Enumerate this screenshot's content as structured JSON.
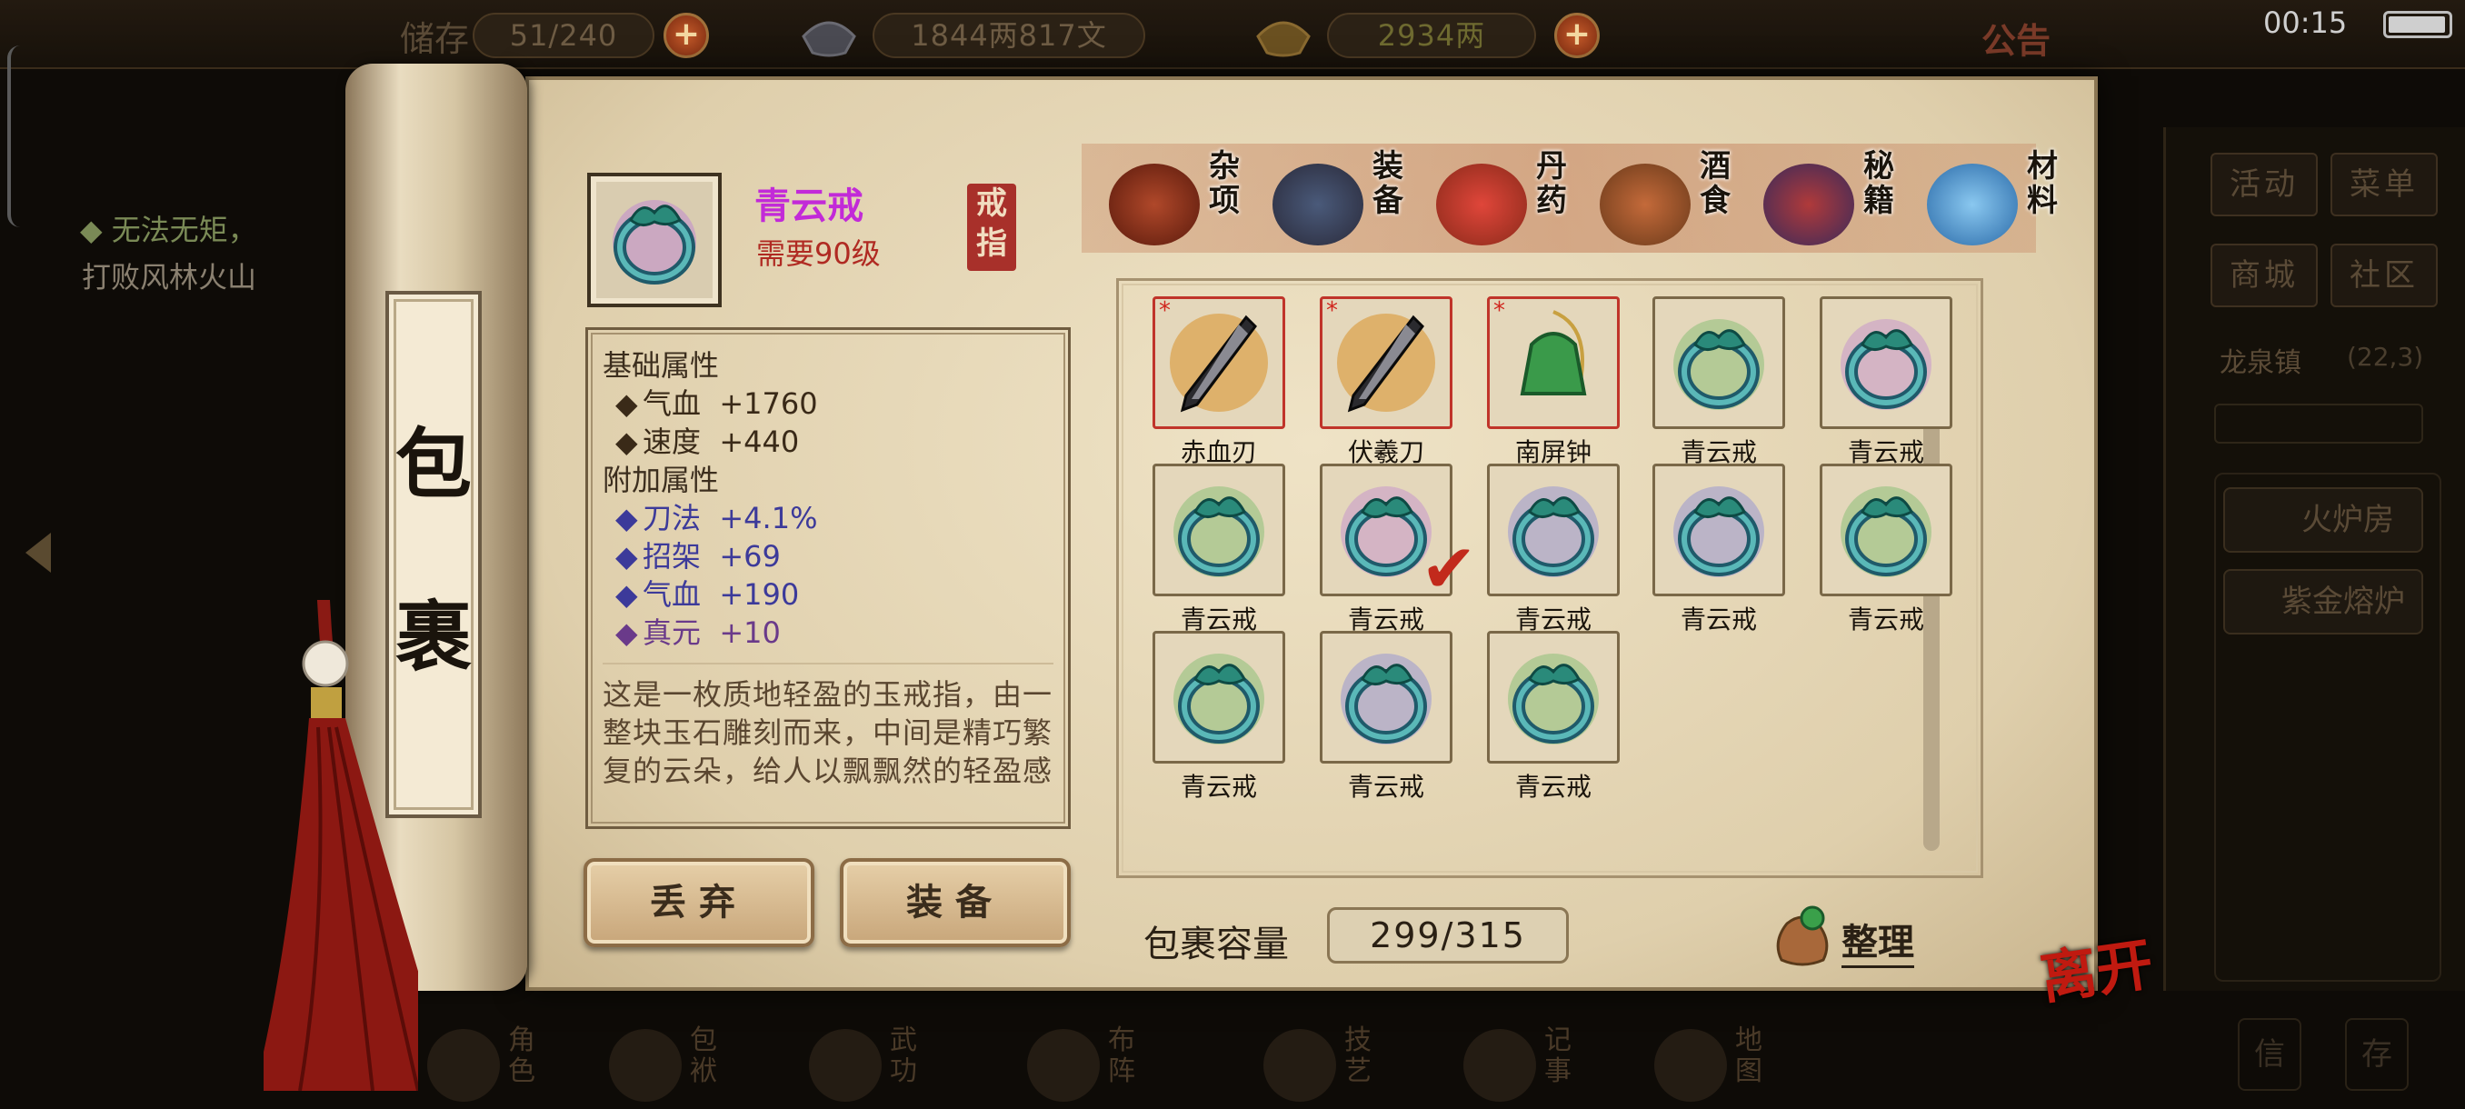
{
  "topbar": {
    "storage": "51/240",
    "storage_prefix": "储存",
    "currency_silver": "1844两817文",
    "currency_gold": "2934两",
    "notice": "公告",
    "time": "00:15"
  },
  "quest": {
    "title": "◆ 无法无矩，",
    "desc": "打败风林火山"
  },
  "right_panel": {
    "activity": "活动",
    "menu": "菜单",
    "mall": "商城",
    "community": "社区",
    "location": "龙泉镇",
    "coords": "(22,3)",
    "furnace_room": "火炉房",
    "purple_furnace": "紫金熔炉",
    "mail": "信",
    "save": "存"
  },
  "scroll_title": [
    "包",
    "裹"
  ],
  "item": {
    "name": "青云戒",
    "requirement": "需要90级",
    "slot": "戒指",
    "base_header": "基础属性",
    "base_stats": [
      {
        "bullet": "◆",
        "name": "气血",
        "value": "+1760"
      },
      {
        "bullet": "◆",
        "name": "速度",
        "value": "+440"
      }
    ],
    "extra_header": "附加属性",
    "extra_stats": [
      {
        "bullet": "◆",
        "name": "刀法",
        "value": "+4.1%"
      },
      {
        "bullet": "◆",
        "name": "招架",
        "value": "+69"
      },
      {
        "bullet": "◆",
        "name": "气血",
        "value": "+190"
      },
      {
        "bullet": "◆",
        "name": "真元",
        "value": "+10"
      }
    ],
    "description": "这是一枚质地轻盈的玉戒指，由一整块玉石雕刻而来，中间是精巧繁复的云朵，给人以飘飘然的轻盈感"
  },
  "actions": {
    "discard": "丢弃",
    "equip": "装备"
  },
  "tabs": [
    {
      "label": "杂项",
      "icon": "jar-icon"
    },
    {
      "label": "装备",
      "icon": "weapons-icon"
    },
    {
      "label": "丹药",
      "icon": "pills-icon"
    },
    {
      "label": "酒食",
      "icon": "food-icon"
    },
    {
      "label": "秘籍",
      "icon": "books-icon"
    },
    {
      "label": "材料",
      "icon": "crystal-icon"
    }
  ],
  "inventory": [
    {
      "name": "赤血刃",
      "icon": "blade-icon",
      "special": true,
      "color": "#d8922a"
    },
    {
      "name": "伏羲刀",
      "icon": "saber-icon",
      "special": true,
      "color": "#d8922a"
    },
    {
      "name": "南屏钟",
      "icon": "bell-icon",
      "special": true,
      "color": "#e0b27a"
    },
    {
      "name": "青云戒",
      "icon": "ring-icon",
      "color": "#7aba6a"
    },
    {
      "name": "青云戒",
      "icon": "ring-icon",
      "color": "#c08ad0"
    },
    {
      "name": "青云戒",
      "icon": "ring-icon",
      "color": "#7aba6a"
    },
    {
      "name": "青云戒",
      "icon": "ring-icon",
      "color": "#c08ad0",
      "equipped": true
    },
    {
      "name": "青云戒",
      "icon": "ring-icon",
      "color": "#8a8ad8"
    },
    {
      "name": "青云戒",
      "icon": "ring-icon",
      "color": "#8a8ad8"
    },
    {
      "name": "青云戒",
      "icon": "ring-icon",
      "color": "#7aba6a"
    },
    {
      "name": "青云戒",
      "icon": "ring-icon",
      "color": "#7aba6a"
    },
    {
      "name": "青云戒",
      "icon": "ring-icon",
      "color": "#8a8ad8"
    },
    {
      "name": "青云戒",
      "icon": "ring-icon",
      "color": "#7aba6a"
    }
  ],
  "capacity": {
    "label": "包裹容量",
    "value": "299/315"
  },
  "sort_label": "整理",
  "leave_label": "离开",
  "bottom_nav": [
    {
      "label": "角色"
    },
    {
      "label": "包袱"
    },
    {
      "label": "武功"
    },
    {
      "label": "布阵"
    },
    {
      "label": "技艺"
    },
    {
      "label": "记事"
    },
    {
      "label": "地图"
    }
  ],
  "colors": {
    "item_name": "#c22ad8",
    "requirement": "#b02a22",
    "extra_stat": "#3c3a9a",
    "leave": "#c01a10"
  }
}
